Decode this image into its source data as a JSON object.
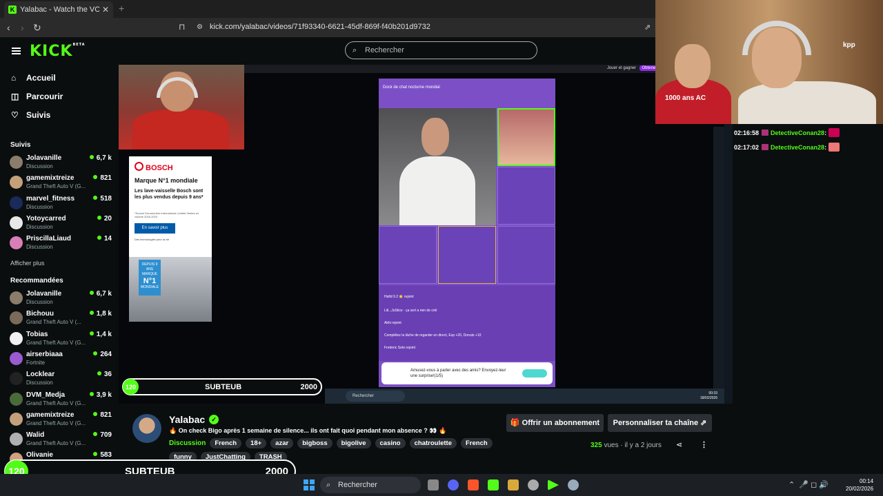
{
  "browser": {
    "tab_title": "Yalabac - Watch the VOD on",
    "tab_close": "✕",
    "new_tab": "+",
    "url": "kick.com/yalabac/videos/71f93340-6621-45df-869f-f40b201d9732"
  },
  "header": {
    "logo": "KICK",
    "logo_badge": "BETA",
    "search_placeholder": "Rechercher"
  },
  "sidebar": {
    "nav": [
      {
        "label": "Accueil",
        "icon": "home-icon"
      },
      {
        "label": "Parcourir",
        "icon": "browse-icon"
      },
      {
        "label": "Suivis",
        "icon": "heart-icon"
      }
    ],
    "followed_title": "Suivis",
    "followed": [
      {
        "name": "Jolavanille",
        "category": "Discussion",
        "viewers": "6,7 k",
        "avatar_color": "#8b7d6b"
      },
      {
        "name": "gamemixtreize",
        "category": "Grand Theft Auto V (G...",
        "viewers": "821",
        "avatar_color": "#c4a07a"
      },
      {
        "name": "marvel_fitness",
        "category": "Discussion",
        "viewers": "518",
        "avatar_color": "#1a2a5a"
      },
      {
        "name": "Yotoycarred",
        "category": "Discussion",
        "viewers": "20",
        "avatar_color": "#e8e8e8"
      },
      {
        "name": "PriscillaLiaud",
        "category": "Discussion",
        "viewers": "14",
        "avatar_color": "#d97fb5"
      }
    ],
    "show_more": "Afficher plus",
    "recommended_title": "Recommandées",
    "recommended": [
      {
        "name": "Jolavanille",
        "category": "Discussion",
        "viewers": "6,7 k",
        "avatar_color": "#8b7d6b"
      },
      {
        "name": "Bichouu",
        "category": "Grand Theft Auto V (...",
        "viewers": "1,8 k",
        "avatar_color": "#7a6a5a"
      },
      {
        "name": "Tobias",
        "category": "Grand Theft Auto V (G...",
        "viewers": "1,4 k",
        "avatar_color": "#f0f0f0"
      },
      {
        "name": "airserbiaaa",
        "category": "Fortnite",
        "viewers": "264",
        "avatar_color": "#9a5ad0"
      },
      {
        "name": "Locklear",
        "category": "Discussion",
        "viewers": "36",
        "avatar_color": "#222222"
      },
      {
        "name": "DVM_Medja",
        "category": "Grand Theft Auto V (G...",
        "viewers": "3,9 k",
        "avatar_color": "#4a6a3a"
      },
      {
        "name": "gamemixtreize",
        "category": "Grand Theft Auto V (G...",
        "viewers": "821",
        "avatar_color": "#c4a07a"
      },
      {
        "name": "Walid",
        "category": "Grand Theft Auto V (G...",
        "viewers": "709",
        "avatar_color": "#b0b0b0"
      },
      {
        "name": "Olivanie",
        "category": "Discussion",
        "viewers": "583",
        "avatar_color": "#d0a080"
      }
    ]
  },
  "video": {
    "top_right_label": "Jouer et gagner",
    "top_right_button": "Obtenez Prime !",
    "ad": {
      "brand": "BOSCH",
      "headline": "Marque N°1 mondiale",
      "body": "Les lave-vaisselle Bosch sont les plus vendus depuis 9 ans*",
      "source": "*Source Euromonitor International Limited Ventes en volume 2016-2024",
      "cta": "En savoir plus",
      "subline": "Des technologies pour la vie",
      "badge_top": "DEPUIS 9 ANS MARQUE",
      "badge_big": "N°1",
      "badge_bottom": "MONDIALE"
    },
    "bigo": {
      "title": "Dock de chat nocturne mondial",
      "chat_lines": [
        "Hafid 9.2 ⭐ rejoint",
        "Lili...JuStice · ça sert a rien de crié",
        "Akhi rejoint",
        "Complétez la tâche de regarder en direct, Exp +20, Donuts +10",
        "Frederic Soto rejoint"
      ],
      "invite_text": "Amusez-vous à parler avec des amis? Envoyez-leur une surprise!(1/5)"
    },
    "inner_taskbar": {
      "search": "Rechercher",
      "time": "00:33",
      "date": "18/02/2026"
    }
  },
  "cam2": {
    "jersey_text": "1000 ans AC",
    "tag": "kpp"
  },
  "chat": {
    "messages": [
      {
        "time": "02:16:58",
        "user": "DetectiveConan28"
      },
      {
        "time": "02:17:02",
        "user": "DetectiveConan28"
      }
    ]
  },
  "subgoal_small": {
    "count": "120",
    "label": "SUBTEUB",
    "goal": "2000",
    "progress": 0.06
  },
  "subgoal_big": {
    "count": "120",
    "label": "SUBTEUB",
    "goal": "2000",
    "progress": 0.06
  },
  "info": {
    "channel_name": "Yalabac",
    "title": "🔥 On check Bigo après 1 semaine de silence... ils ont fait quoi pendant mon absence ? 👀 🔥",
    "category": "Discussion",
    "tags_row1": [
      "French",
      "18+",
      "azar",
      "bigboss",
      "bigolive",
      "casino",
      "chatroulette",
      "French"
    ],
    "tags_row2": [
      "funny",
      "JustChatting",
      "TRASH"
    ],
    "subscribe_button": "Offrir un abonnement",
    "customize_button": "Personnaliser ta chaîne",
    "views_count": "325",
    "views_label": "vues",
    "time_ago": "il y a 2 jours"
  },
  "taskbar": {
    "search": "Rechercher",
    "time": "00:14",
    "date": "20/02/2026"
  }
}
